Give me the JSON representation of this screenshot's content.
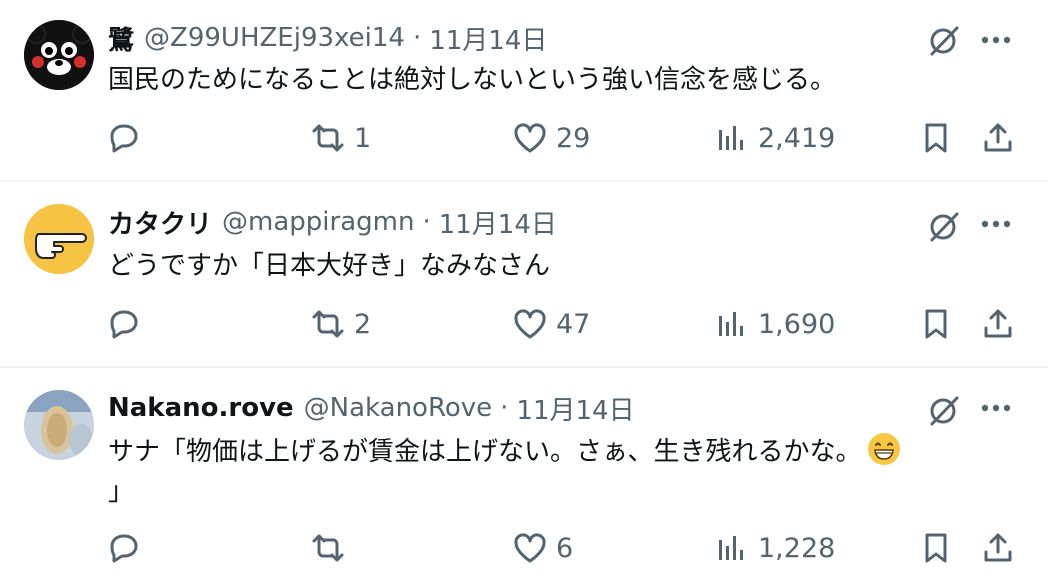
{
  "posts": [
    {
      "name": "鷺",
      "handle": "@Z99UHZEj93xei14",
      "sep": "·",
      "time": "11月14日",
      "text_lines": [
        "国民のためになることは絶対しないという強い信念を感じる。"
      ],
      "reply_count": "",
      "repost_count": "1",
      "like_count": "29",
      "view_count": "2,419",
      "avatar": "kumamon-face"
    },
    {
      "name": "カタクリ",
      "handle": "@mappiragmn",
      "sep": "·",
      "time": "11月14日",
      "text_lines": [
        "どうですか「日本大好き」なみなさん"
      ],
      "reply_count": "",
      "repost_count": "2",
      "like_count": "47",
      "view_count": "1,690",
      "avatar": "pointing-hand"
    },
    {
      "name": "Nakano.rove",
      "handle": "@NakanoRove",
      "sep": "·",
      "time": "11月14日",
      "text_lines": [
        "サナ「物価は上げるが賃金は上げない。さぁ、生き残れるかな。",
        "」"
      ],
      "emoji": "grinning-face",
      "reply_count": "",
      "repost_count": "",
      "like_count": "6",
      "view_count": "1,228",
      "avatar": "photo"
    }
  ],
  "colors": {
    "text": "#0f1419",
    "secondary": "#536471",
    "divider": "#eff3f4"
  },
  "icons": [
    "reply-icon",
    "repost-icon",
    "like-icon",
    "views-icon",
    "bookmark-icon",
    "share-icon",
    "grok-icon",
    "more-icon"
  ]
}
